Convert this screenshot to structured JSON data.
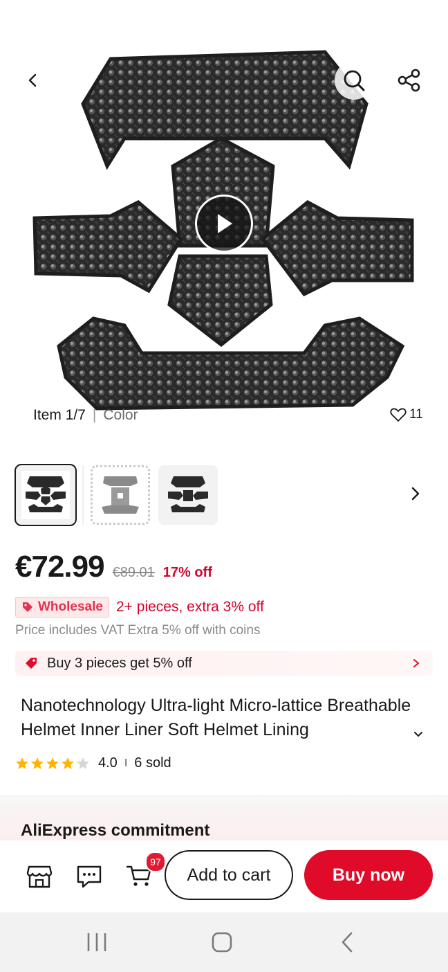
{
  "header": {
    "back_icon": "chevron-left-icon",
    "search_icon": "search-icon",
    "share_icon": "share-icon",
    "play_icon": "play-icon"
  },
  "gallery": {
    "item_label": "Item 1/7",
    "separator": "|",
    "variant_label": "Color",
    "like_count": "11",
    "thumbnails": [
      "black-liner",
      "grey-liner",
      "black-liner-alt"
    ]
  },
  "pricing": {
    "price": "€72.99",
    "original_price": "€89.01",
    "discount": "17% off",
    "wholesale_badge": "Wholesale",
    "wholesale_text": "2+ pieces, extra 3% off",
    "vat_text": "Price includes VAT Extra 5% off with coins",
    "coupon_text": "Buy 3 pieces get 5% off"
  },
  "product": {
    "title": "Nanotechnology Ultra-light Micro-lattice Breathable Helmet Inner Liner Soft Helmet Lining",
    "rating": "4.0",
    "rating_stars": 4,
    "divider": "I",
    "sold": "6 sold"
  },
  "commitment": {
    "heading": "AliExpress commitment"
  },
  "bottom_bar": {
    "cart_count": "97",
    "add_to_cart": "Add to cart",
    "buy_now": "Buy now"
  },
  "colors": {
    "accent": "#e00a29",
    "discount": "#d3032b",
    "star": "#ffb400"
  }
}
